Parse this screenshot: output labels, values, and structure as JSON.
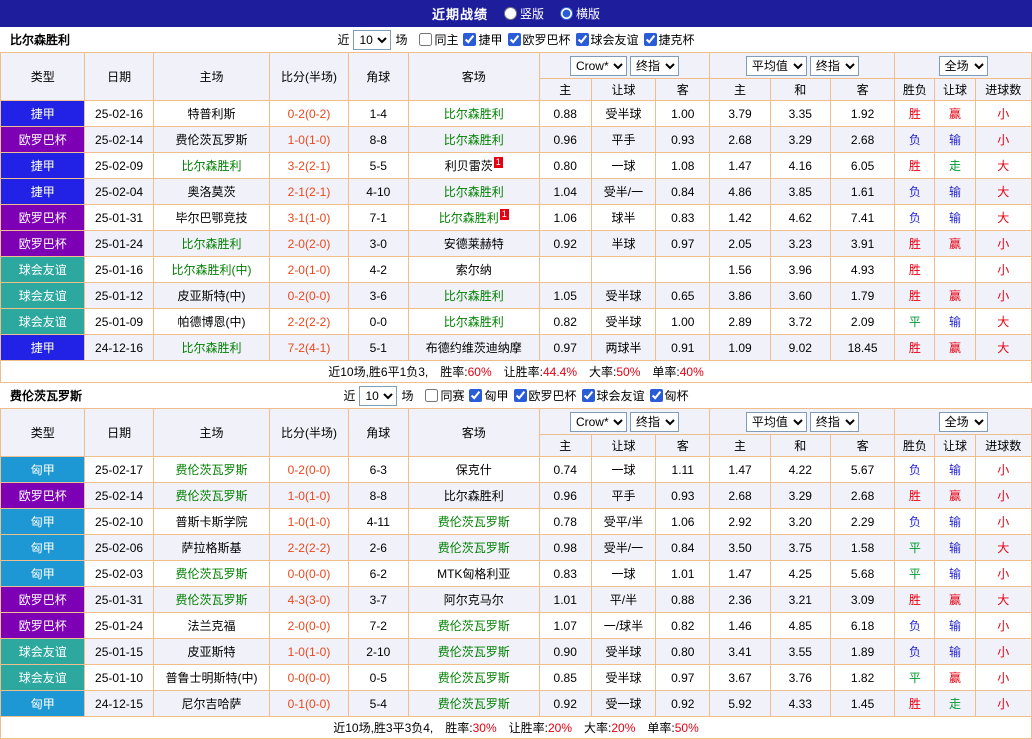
{
  "top_bar": {
    "title": "近期战绩",
    "options": [
      {
        "label": "竖版",
        "selected": false
      },
      {
        "label": "横版",
        "selected": true
      }
    ]
  },
  "filter_labels": {
    "near": "近",
    "games": "场"
  },
  "controls": {
    "odds_company": "Crow*",
    "odds_final": "终指",
    "avg": "平均值",
    "avg_final": "终指",
    "full": "全场"
  },
  "table_header": {
    "type": "类型",
    "date": "日期",
    "home": "主场",
    "score": "比分(半场)",
    "corner": "角球",
    "away": "客场",
    "sub": [
      "主",
      "让球",
      "客",
      "主",
      "和",
      "客",
      "胜负",
      "让球",
      "进球数"
    ]
  },
  "league_colors": {
    "捷甲": "#2222e6",
    "欧罗巴杯": "#7e00b5",
    "球会友谊": "#2ca89f",
    "匈甲": "#1e97d5"
  },
  "result_colors": {
    "胜": "#e60012",
    "负": "#2626cc",
    "平": "#009933",
    "赢": "#e60012",
    "输": "#2626cc",
    "走": "#009933",
    "大": "#e60012",
    "小": "#e60012"
  },
  "sections": [
    {
      "team": "比尔森胜利",
      "filter": {
        "count": "10",
        "checkboxes": [
          {
            "label": "同主",
            "checked": false
          },
          {
            "label": "捷甲",
            "checked": true
          },
          {
            "label": "欧罗巴杯",
            "checked": true
          },
          {
            "label": "球会友谊",
            "checked": true
          },
          {
            "label": "捷克杯",
            "checked": true
          }
        ]
      },
      "rows": [
        {
          "league": "捷甲",
          "date": "25-02-16",
          "home": "特普利斯",
          "home_focus": false,
          "score": "0-2(0-2)",
          "corner": "1-4",
          "away": "比尔森胜利",
          "away_focus": true,
          "odds": [
            "0.88",
            "受半球",
            "1.00"
          ],
          "avg": [
            "3.79",
            "3.35",
            "1.92"
          ],
          "res": [
            "胜",
            "赢",
            "小"
          ]
        },
        {
          "league": "欧罗巴杯",
          "date": "25-02-14",
          "home": "费伦茨瓦罗斯",
          "home_focus": false,
          "score": "1-0(1-0)",
          "corner": "8-8",
          "away": "比尔森胜利",
          "away_focus": true,
          "odds": [
            "0.96",
            "平手",
            "0.93"
          ],
          "avg": [
            "2.68",
            "3.29",
            "2.68"
          ],
          "res": [
            "负",
            "输",
            "小"
          ]
        },
        {
          "league": "捷甲",
          "date": "25-02-09",
          "home": "比尔森胜利",
          "home_focus": true,
          "score": "3-2(2-1)",
          "corner": "5-5",
          "away": "利贝雷茨",
          "away_focus": false,
          "away_card": "1",
          "odds": [
            "0.80",
            "一球",
            "1.08"
          ],
          "avg": [
            "1.47",
            "4.16",
            "6.05"
          ],
          "res": [
            "胜",
            "走",
            "大"
          ]
        },
        {
          "league": "捷甲",
          "date": "25-02-04",
          "home": "奥洛莫茨",
          "home_focus": false,
          "score": "2-1(2-1)",
          "corner": "4-10",
          "away": "比尔森胜利",
          "away_focus": true,
          "odds": [
            "1.04",
            "受半/一",
            "0.84"
          ],
          "avg": [
            "4.86",
            "3.85",
            "1.61"
          ],
          "res": [
            "负",
            "输",
            "大"
          ]
        },
        {
          "league": "欧罗巴杯",
          "date": "25-01-31",
          "home": "毕尔巴鄂竞技",
          "home_focus": false,
          "score": "3-1(1-0)",
          "corner": "7-1",
          "away": "比尔森胜利",
          "away_focus": true,
          "away_card": "1",
          "odds": [
            "1.06",
            "球半",
            "0.83"
          ],
          "avg": [
            "1.42",
            "4.62",
            "7.41"
          ],
          "res": [
            "负",
            "输",
            "大"
          ]
        },
        {
          "league": "欧罗巴杯",
          "date": "25-01-24",
          "home": "比尔森胜利",
          "home_focus": true,
          "score": "2-0(2-0)",
          "corner": "3-0",
          "away": "安德莱赫特",
          "away_focus": false,
          "odds": [
            "0.92",
            "半球",
            "0.97"
          ],
          "avg": [
            "2.05",
            "3.23",
            "3.91"
          ],
          "res": [
            "胜",
            "赢",
            "小"
          ]
        },
        {
          "league": "球会友谊",
          "date": "25-01-16",
          "home": "比尔森胜利(中)",
          "home_focus": true,
          "score": "2-0(1-0)",
          "corner": "4-2",
          "away": "索尔纳",
          "away_focus": false,
          "odds": [
            "",
            "",
            ""
          ],
          "avg": [
            "1.56",
            "3.96",
            "4.93"
          ],
          "res": [
            "胜",
            "",
            "小"
          ]
        },
        {
          "league": "球会友谊",
          "date": "25-01-12",
          "home": "皮亚斯特(中)",
          "home_focus": false,
          "score": "0-2(0-0)",
          "corner": "3-6",
          "away": "比尔森胜利",
          "away_focus": true,
          "odds": [
            "1.05",
            "受半球",
            "0.65"
          ],
          "avg": [
            "3.86",
            "3.60",
            "1.79"
          ],
          "res": [
            "胜",
            "赢",
            "小"
          ]
        },
        {
          "league": "球会友谊",
          "date": "25-01-09",
          "home": "帕德博恩(中)",
          "home_focus": false,
          "score": "2-2(2-2)",
          "corner": "0-0",
          "away": "比尔森胜利",
          "away_focus": true,
          "odds": [
            "0.82",
            "受半球",
            "1.00"
          ],
          "avg": [
            "2.89",
            "3.72",
            "2.09"
          ],
          "res": [
            "平",
            "输",
            "大"
          ]
        },
        {
          "league": "捷甲",
          "date": "24-12-16",
          "home": "比尔森胜利",
          "home_focus": true,
          "score": "7-2(4-1)",
          "corner": "5-1",
          "away": "布德约维茨迪纳摩",
          "away_focus": false,
          "odds": [
            "0.97",
            "两球半",
            "0.91"
          ],
          "avg": [
            "1.09",
            "9.02",
            "18.45"
          ],
          "res": [
            "胜",
            "赢",
            "大"
          ]
        }
      ],
      "summary": {
        "prefix": "近10场,胜6平1负3,",
        "stats": [
          {
            "label": "胜率:",
            "value": "60%",
            "color": "#e60012"
          },
          {
            "label": "让胜率:",
            "value": "44.4%",
            "color": "#e60012"
          },
          {
            "label": "大率:",
            "value": "50%",
            "color": "#e60012"
          },
          {
            "label": "单率:",
            "value": "40%",
            "color": "#e60012"
          }
        ]
      }
    },
    {
      "team": "费伦茨瓦罗斯",
      "filter": {
        "count": "10",
        "checkboxes": [
          {
            "label": "同赛",
            "checked": false
          },
          {
            "label": "匈甲",
            "checked": true
          },
          {
            "label": "欧罗巴杯",
            "checked": true
          },
          {
            "label": "球会友谊",
            "checked": true
          },
          {
            "label": "匈杯",
            "checked": true
          }
        ]
      },
      "rows": [
        {
          "league": "匈甲",
          "date": "25-02-17",
          "home": "费伦茨瓦罗斯",
          "home_focus": true,
          "score": "0-2(0-0)",
          "corner": "6-3",
          "away": "保克什",
          "away_focus": false,
          "odds": [
            "0.74",
            "一球",
            "1.11"
          ],
          "avg": [
            "1.47",
            "4.22",
            "5.67"
          ],
          "res": [
            "负",
            "输",
            "小"
          ]
        },
        {
          "league": "欧罗巴杯",
          "date": "25-02-14",
          "home": "费伦茨瓦罗斯",
          "home_focus": true,
          "score": "1-0(1-0)",
          "corner": "8-8",
          "away": "比尔森胜利",
          "away_focus": false,
          "odds": [
            "0.96",
            "平手",
            "0.93"
          ],
          "avg": [
            "2.68",
            "3.29",
            "2.68"
          ],
          "res": [
            "胜",
            "赢",
            "小"
          ]
        },
        {
          "league": "匈甲",
          "date": "25-02-10",
          "home": "普斯卡斯学院",
          "home_focus": false,
          "score": "1-0(1-0)",
          "corner": "4-11",
          "away": "费伦茨瓦罗斯",
          "away_focus": true,
          "odds": [
            "0.78",
            "受平/半",
            "1.06"
          ],
          "avg": [
            "2.92",
            "3.20",
            "2.29"
          ],
          "res": [
            "负",
            "输",
            "小"
          ]
        },
        {
          "league": "匈甲",
          "date": "25-02-06",
          "home": "萨拉格斯基",
          "home_focus": false,
          "score": "2-2(2-2)",
          "corner": "2-6",
          "away": "费伦茨瓦罗斯",
          "away_focus": true,
          "odds": [
            "0.98",
            "受半/一",
            "0.84"
          ],
          "avg": [
            "3.50",
            "3.75",
            "1.58"
          ],
          "res": [
            "平",
            "输",
            "大"
          ]
        },
        {
          "league": "匈甲",
          "date": "25-02-03",
          "home": "费伦茨瓦罗斯",
          "home_focus": true,
          "score": "0-0(0-0)",
          "corner": "6-2",
          "away": "MTK匈格利亚",
          "away_focus": false,
          "odds": [
            "0.83",
            "一球",
            "1.01"
          ],
          "avg": [
            "1.47",
            "4.25",
            "5.68"
          ],
          "res": [
            "平",
            "输",
            "小"
          ]
        },
        {
          "league": "欧罗巴杯",
          "date": "25-01-31",
          "home": "费伦茨瓦罗斯",
          "home_focus": true,
          "score": "4-3(3-0)",
          "corner": "3-7",
          "away": "阿尔克马尔",
          "away_focus": false,
          "odds": [
            "1.01",
            "平/半",
            "0.88"
          ],
          "avg": [
            "2.36",
            "3.21",
            "3.09"
          ],
          "res": [
            "胜",
            "赢",
            "大"
          ]
        },
        {
          "league": "欧罗巴杯",
          "date": "25-01-24",
          "home": "法兰克福",
          "home_focus": false,
          "score": "2-0(0-0)",
          "corner": "7-2",
          "away": "费伦茨瓦罗斯",
          "away_focus": true,
          "odds": [
            "1.07",
            "一/球半",
            "0.82"
          ],
          "avg": [
            "1.46",
            "4.85",
            "6.18"
          ],
          "res": [
            "负",
            "输",
            "小"
          ]
        },
        {
          "league": "球会友谊",
          "date": "25-01-15",
          "home": "皮亚斯特",
          "home_focus": false,
          "score": "1-0(1-0)",
          "corner": "2-10",
          "away": "费伦茨瓦罗斯",
          "away_focus": true,
          "odds": [
            "0.90",
            "受半球",
            "0.80"
          ],
          "avg": [
            "3.41",
            "3.55",
            "1.89"
          ],
          "res": [
            "负",
            "输",
            "小"
          ]
        },
        {
          "league": "球会友谊",
          "date": "25-01-10",
          "home": "普鲁士明斯特(中)",
          "home_focus": false,
          "score": "0-0(0-0)",
          "corner": "0-5",
          "away": "费伦茨瓦罗斯",
          "away_focus": true,
          "odds": [
            "0.85",
            "受半球",
            "0.97"
          ],
          "avg": [
            "3.67",
            "3.76",
            "1.82"
          ],
          "res": [
            "平",
            "赢",
            "小"
          ]
        },
        {
          "league": "匈甲",
          "date": "24-12-15",
          "home": "尼尔吉哈萨",
          "home_focus": false,
          "score": "0-1(0-0)",
          "corner": "5-4",
          "away": "费伦茨瓦罗斯",
          "away_focus": true,
          "odds": [
            "0.92",
            "受一球",
            "0.92"
          ],
          "avg": [
            "5.92",
            "4.33",
            "1.45"
          ],
          "res": [
            "胜",
            "走",
            "小"
          ]
        }
      ],
      "summary": {
        "prefix": "近10场,胜3平3负4,",
        "stats": [
          {
            "label": "胜率:",
            "value": "30%",
            "color": "#e60012"
          },
          {
            "label": "让胜率:",
            "value": "20%",
            "color": "#e60012"
          },
          {
            "label": "大率:",
            "value": "20%",
            "color": "#e60012"
          },
          {
            "label": "单率:",
            "value": "50%",
            "color": "#e60012"
          }
        ]
      }
    }
  ]
}
